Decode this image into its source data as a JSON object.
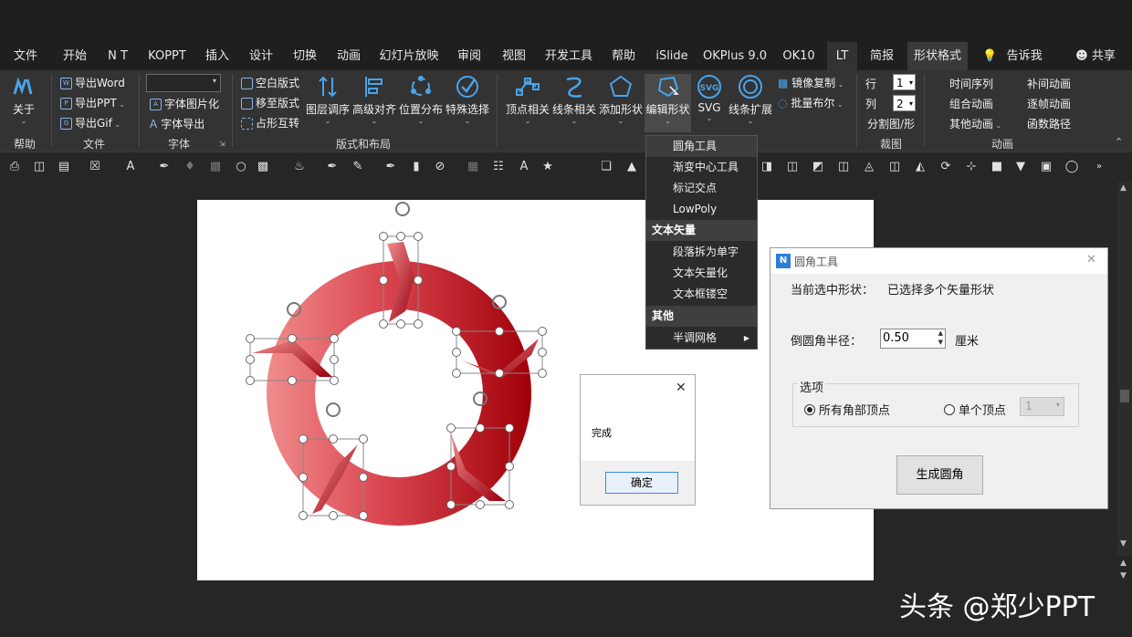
{
  "tabs": [
    "文件",
    "开始",
    "N T",
    "KOPPT",
    "插入",
    "设计",
    "切换",
    "动画",
    "幻灯片放映",
    "审阅",
    "视图",
    "开发工具",
    "帮助",
    "iSlide",
    "OKPlus 9.0",
    "OK10",
    "LT",
    "简报",
    "形状格式"
  ],
  "tell_me": "告诉我",
  "share": "共享",
  "ribbon": {
    "about": "关于",
    "help_group": "帮助",
    "export_word": "导出Word",
    "export_ppt": "导出PPT",
    "export_gif": "导出Gif",
    "file_group": "文件",
    "font_img": "字体图片化",
    "font_export": "字体导出",
    "font_group": "字体",
    "blank_layout": "空白版式",
    "move_layout": "移至版式",
    "placeholder_swap": "占形互转",
    "layer_order": "图层调序",
    "adv_align": "高级对齐",
    "pos_dist": "位置分布",
    "special_select": "特殊选择",
    "layout_group": "版式和布局",
    "vertex": "顶点相关",
    "line": "线条相关",
    "add_shape": "添加形状",
    "edit_shape": "编辑形状",
    "svg": "SVG",
    "line_ext": "线条扩展",
    "mirror_copy": "镜像复制",
    "batch_bool": "批量布尔",
    "row": "行",
    "col": "列",
    "row_val": "1",
    "col_val": "2",
    "split": "分割图/形",
    "crop_group": "裁图",
    "time_seq": "时间序列",
    "combo_anim": "组合动画",
    "other_anim": "其他动画",
    "tween_anim": "补间动画",
    "frame_anim": "逐帧动画",
    "func_path": "函数路径",
    "anim_group": "动画"
  },
  "menu": {
    "items1": [
      "圆角工具",
      "渐变中心工具",
      "标记交点",
      "LowPoly"
    ],
    "header2": "文本矢量",
    "items2": [
      "段落拆为单字",
      "文本矢量化",
      "文本框镂空"
    ],
    "header3": "其他",
    "items3": [
      "半调网格"
    ]
  },
  "done_dialog": {
    "message": "完成",
    "ok": "确定"
  },
  "rc_dialog": {
    "title": "圆角工具",
    "current_label": "当前选中形状：",
    "current_value": "已选择多个矢量形状",
    "radius_label": "倒圆角半径：",
    "radius_value": "0.50",
    "unit": "厘米",
    "options_label": "选项",
    "all_vertices": "所有角部顶点",
    "single_vertex": "单个顶点",
    "vertex_num": "1",
    "generate": "生成圆角"
  },
  "watermark": "头条 @郑少PPT",
  "colors": {
    "accent_blue": "#3c8ce8",
    "ring_dark": "#a00008",
    "ring_light": "#f08c8c"
  }
}
